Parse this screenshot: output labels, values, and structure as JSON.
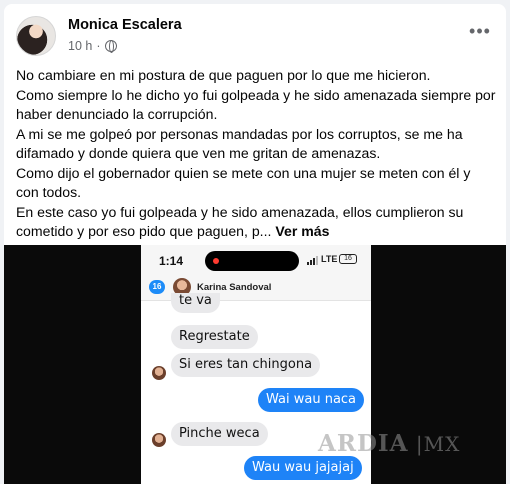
{
  "post": {
    "author": "Monica Escalera",
    "time": "10 h",
    "separator": "·",
    "more_label": "•••",
    "lines": [
      "No cambiare en mi postura de que paguen por lo que me hicieron.",
      "Como siempre lo he dicho yo fui golpeada y he sido amenazada siempre por",
      "haber denunciado la corrupción.",
      "A mi se me golpeó por personas mandadas por los corruptos, se me ha",
      "difamado y donde quiera que ven me gritan de amenazas.",
      "Como dijo el gobernador quien se mete con una mujer se meten con él y",
      "con todos.",
      "En este caso yo fui golpeada y he sido amenazada, ellos cumplieron su"
    ],
    "last_line": "cometido y por eso pido que paguen, p...",
    "see_more": "Ver más"
  },
  "screenshot": {
    "time": "1:14",
    "network": "LTE",
    "battery": "16",
    "back_count": "16",
    "contact": "Karina Sandoval",
    "messages": [
      {
        "text": "te va",
        "direction": "in"
      },
      {
        "text": "Regrestate",
        "direction": "in"
      },
      {
        "text": "Si eres tan chingona",
        "direction": "in"
      },
      {
        "text": "Wai wau naca",
        "direction": "out"
      },
      {
        "text": "Pinche weca",
        "direction": "in"
      },
      {
        "text": "Wau wau jajajaj",
        "direction": "out"
      }
    ],
    "watermark": "ARDIA",
    "watermark_suffix": "MX"
  },
  "colors": {
    "outgoing_bubble": "#1e83f7",
    "incoming_bubble": "#e9e9eb",
    "secondary_text": "#65676b"
  }
}
